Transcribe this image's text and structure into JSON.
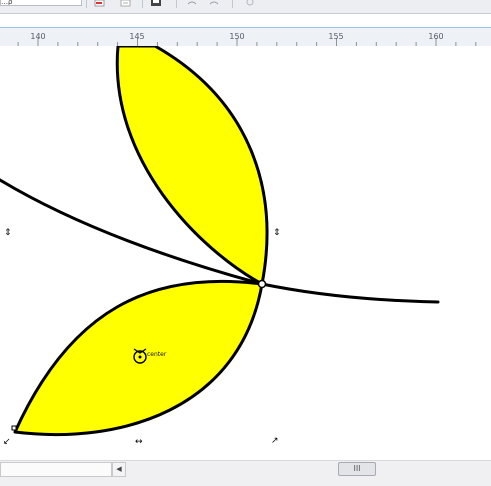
{
  "toolbar": {
    "field_value": "…ρ",
    "icons": [
      "pdf-icon",
      "export-icon",
      "print-icon",
      "undo-icon",
      "redo-icon",
      "zoom-icon"
    ]
  },
  "ruler": {
    "ticks": [
      "140",
      "145",
      "150",
      "155",
      "160"
    ]
  },
  "canvas": {
    "center_label": "center",
    "colors": {
      "petal_fill": "#ffff00",
      "outline": "#000000"
    },
    "handles": {
      "left": "⇕",
      "right": "⇕",
      "bottom_left": "↙",
      "bottom_middle": "↔",
      "bottom_right": "↗"
    }
  },
  "scrollbar": {
    "left_arrow": "◀",
    "thumb_grip": "III"
  }
}
